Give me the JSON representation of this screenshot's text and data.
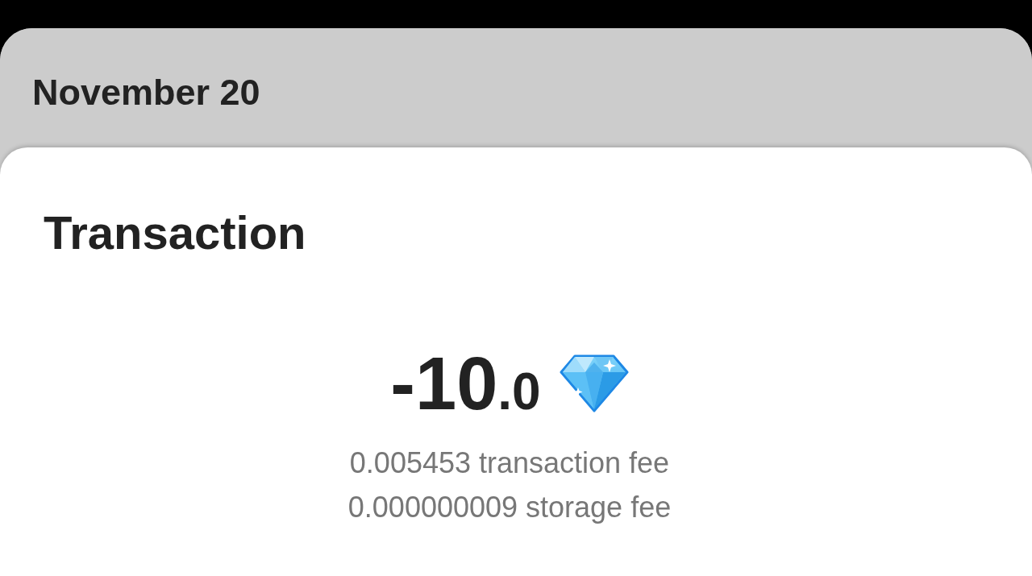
{
  "header": {
    "date": "November 20"
  },
  "card": {
    "title": "Transaction",
    "amount": {
      "whole": "-10",
      "fraction": ".0"
    },
    "fees": [
      "0.005453 transaction fee",
      "0.000000009 storage fee"
    ]
  }
}
